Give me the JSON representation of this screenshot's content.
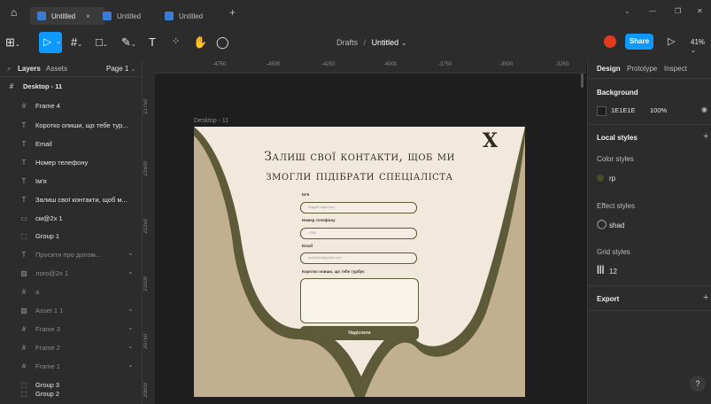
{
  "titlebar": {
    "home_icon": "home-icon",
    "tabs": [
      {
        "label": "Untitled",
        "close": "×"
      },
      {
        "label": "Untitled"
      },
      {
        "label": "Untitled"
      }
    ],
    "add_tab": "+",
    "window_controls": [
      "⌄",
      "—",
      "❐",
      "✕"
    ]
  },
  "toolbar": {
    "breadcrumb_project": "Drafts",
    "breadcrumb_sep": "/",
    "file_name": "Untitled",
    "file_chevron": "⌄",
    "share_label": "Share",
    "zoom": "41%",
    "avatar_color": "#e23a1f"
  },
  "left_panel": {
    "tab_layers": "Layers",
    "tab_assets": "Assets",
    "page": "Page 1",
    "root": "Desktop - 11",
    "layers": [
      {
        "label": "Frame 4",
        "icon": "#"
      },
      {
        "label": "Коротко опиши, що тебе тур...",
        "icon": "T"
      },
      {
        "label": "Email",
        "icon": "T"
      },
      {
        "label": "Номер телефону",
        "icon": "T"
      },
      {
        "label": "Ім'я",
        "icon": "T"
      },
      {
        "label": "Залиш свої контакти, щоб м...",
        "icon": "T"
      },
      {
        "label": "см@2x 1",
        "icon": "▭"
      },
      {
        "label": "Group 1",
        "icon": "⬚"
      },
      {
        "label": "Просити про допом...",
        "icon": "T"
      },
      {
        "label": "лого@2x 1",
        "icon": "▨"
      },
      {
        "label": "а",
        "icon": "#"
      },
      {
        "label": "Asset 1 1",
        "icon": "▨"
      },
      {
        "label": "Frame 3",
        "icon": "#"
      },
      {
        "label": "Frame 2",
        "icon": "#"
      },
      {
        "label": "Frame 1",
        "icon": "#"
      },
      {
        "label": "Group 3",
        "icon": "⬚"
      },
      {
        "label": "Group 2",
        "icon": "⬚"
      }
    ]
  },
  "rulers": {
    "top": [
      "-4750",
      "-4500",
      "-4250",
      "-4000",
      "-3750",
      "-3500",
      "-3250"
    ],
    "left": [
      "21750",
      "21500",
      "21250",
      "21000",
      "20750",
      "20500"
    ]
  },
  "canvas": {
    "frame_label": "Desktop - 11",
    "title_line1": "Залиш свої контакти, щоб ми",
    "title_line2": "змогли підібрати спеціаліста",
    "close_mark": "X",
    "label_name": "Ім'я",
    "placeholder_name": "Андрій Іваненко",
    "label_phone": "Номер телефону",
    "placeholder_phone": "+380",
    "label_email": "Email",
    "placeholder_email": "andrivan@gmail.com",
    "label_message": "Коротко опиши, що тебе турбує",
    "submit_label": "Надіслати"
  },
  "right_panel": {
    "tabs": [
      "Design",
      "Prototype",
      "Inspect"
    ],
    "background_title": "Background",
    "background_hex": "1E1E1E",
    "background_opacity": "100%",
    "local_styles": "Local styles",
    "color_styles": "Color styles",
    "color_style_name": "rp",
    "effect_styles": "Effect styles",
    "effect_style_name": "shad",
    "grid_styles": "Grid styles",
    "grid_style_name": "12",
    "export": "Export",
    "help": "?"
  },
  "colors": {
    "accent": "#0d99ff",
    "frame_bg": "#c0b090",
    "card_bg": "#f0e9dc",
    "olive": "#5c5a38"
  }
}
